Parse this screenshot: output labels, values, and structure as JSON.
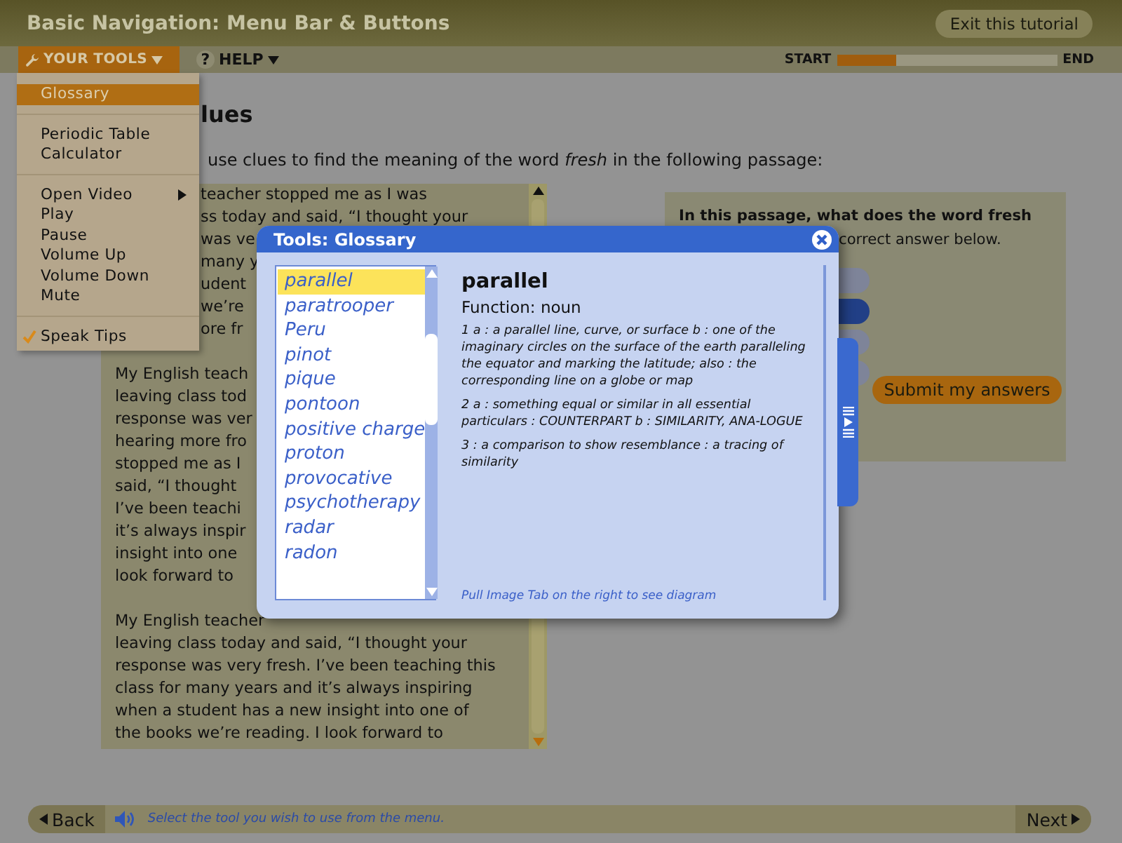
{
  "header": {
    "title": "Basic Navigation: Menu Bar & Buttons",
    "exit_button": "Exit this tutorial"
  },
  "toolbar": {
    "tools_menu": {
      "label": "YOUR TOOLS",
      "expanded": true
    },
    "help_menu": {
      "icon": "?",
      "label": "HELP",
      "expanded": false
    },
    "progress": {
      "start": "START",
      "end": "END",
      "level": 0.27
    }
  },
  "lesson": {
    "heading": "lues",
    "instruction": "use clues to find the meaning of the word *fresh* in the following passage:",
    "passage": [
      {
        "kind": "partial",
        "lines": [
          "teacher stopped me as I was",
          "ss today and said, “I thought your",
          "was ve",
          "many y",
          "udent",
          "we’re",
          "ore fr"
        ]
      },
      {
        "kind": "full",
        "lines": [
          "My English teach",
          "leaving class tod",
          "response was ver",
          "hearing more fro",
          "stopped me as I",
          "said, “I thought",
          "I’ve been teachi",
          "it’s always inspir",
          "insight into one",
          "look forward to"
        ]
      },
      {
        "kind": "full",
        "lines": [
          "My English teacher",
          "leaving class today and said, “I thought your",
          "response was very fresh. I’ve been teaching this",
          "class for many years and it’s always inspiring",
          "when a student has a new insight into one of",
          "the books we’re reading. I look forward to"
        ]
      }
    ],
    "question": {
      "line_1": "In this passage, what does the word fresh",
      "line_2": "correct answer below."
    },
    "options": [
      {
        "selected": false
      },
      {
        "selected": true
      },
      {
        "selected": false
      },
      {
        "selected": false
      }
    ],
    "submit_button": "Submit my answers"
  },
  "tools_dropdown": {
    "groups": [
      [
        {
          "label": "Glossary",
          "selected": true,
          "checked": false,
          "submenu": false
        }
      ],
      [
        {
          "label": "Periodic Table",
          "selected": false,
          "checked": false,
          "submenu": false
        },
        {
          "label": "Calculator",
          "selected": false,
          "checked": false,
          "submenu": false
        }
      ],
      [
        {
          "label": "Open Video",
          "selected": false,
          "checked": false,
          "submenu": true
        },
        {
          "label": "Play",
          "selected": false,
          "checked": false,
          "submenu": false
        },
        {
          "label": "Pause",
          "selected": false,
          "checked": false,
          "submenu": false
        },
        {
          "label": "Volume Up",
          "selected": false,
          "checked": false,
          "submenu": false
        },
        {
          "label": "Volume Down",
          "selected": false,
          "checked": false,
          "submenu": false
        },
        {
          "label": "Mute",
          "selected": false,
          "checked": false,
          "submenu": false
        }
      ],
      [
        {
          "label": "Speak Tips",
          "selected": false,
          "checked": true,
          "submenu": false
        }
      ]
    ]
  },
  "glossary_dialog": {
    "title": "Tools: Glossary",
    "terms": [
      {
        "label": "parallel",
        "selected": true
      },
      {
        "label": "paratrooper",
        "selected": false
      },
      {
        "label": "Peru",
        "selected": false
      },
      {
        "label": "pinot",
        "selected": false
      },
      {
        "label": "pique",
        "selected": false
      },
      {
        "label": "pontoon",
        "selected": false
      },
      {
        "label": "positive charge",
        "selected": false
      },
      {
        "label": "proton",
        "selected": false
      },
      {
        "label": "provocative",
        "selected": false
      },
      {
        "label": "psychotherapy",
        "selected": false
      },
      {
        "label": "radar",
        "selected": false
      },
      {
        "label": "radon",
        "selected": false
      }
    ],
    "entry": {
      "word": "parallel",
      "function": "Function: noun",
      "definitions": [
        "1 a : a parallel line, curve, or surface b : one of the imaginary circles on the surface of the earth paralleling the equator and marking the latitude; also : the corresponding line on a globe or map",
        "2 a : something equal or similar in all essential particulars : COUNTERPART b : SIMILARITY, ANA-LOGUE",
        "3 : a comparison to show resemblance : a tracing of similarity"
      ]
    },
    "hint": "Pull Image Tab on the right to see diagram"
  },
  "footer": {
    "back_button": "Back",
    "hint": "Select the tool you wish to use from the menu.",
    "next_button": "Next"
  }
}
